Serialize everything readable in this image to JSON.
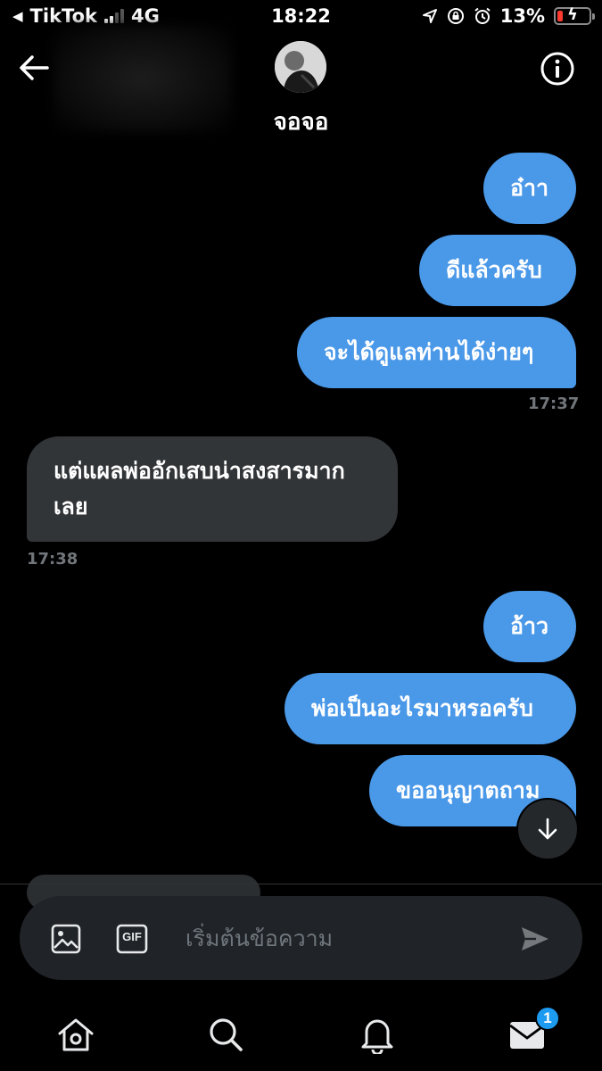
{
  "status_bar": {
    "back_app": "TikTok",
    "network": "4G",
    "time": "18:22",
    "battery": "13%"
  },
  "header": {
    "contact_name": "จอจอ"
  },
  "messages": [
    {
      "text": "อ๋าา",
      "direction": "out"
    },
    {
      "text": "ดีแล้วครับ",
      "direction": "out"
    },
    {
      "text": "จะได้ดูแลท่านได้ง่ายๆ",
      "direction": "out"
    },
    {
      "time": "17:37"
    },
    {
      "text": "แต่แผลพ่ออักเสบน่าสงสารมาก เลย",
      "direction": "in"
    },
    {
      "time": "17:38"
    },
    {
      "text": "อ้าว",
      "direction": "out"
    },
    {
      "text": "พ่อเป็นอะไรมาหรอครับ",
      "direction": "out"
    },
    {
      "text": "ขออนุญาตถาม",
      "direction": "out"
    }
  ],
  "composer": {
    "placeholder": "เริ่มต้นข้อความ",
    "gif_label": "GIF"
  },
  "nav": {
    "messages_badge": "1"
  },
  "colors": {
    "outgoing_bubble": "#4a98e8",
    "incoming_bubble": "#323538",
    "accent": "#1d9bf0"
  }
}
